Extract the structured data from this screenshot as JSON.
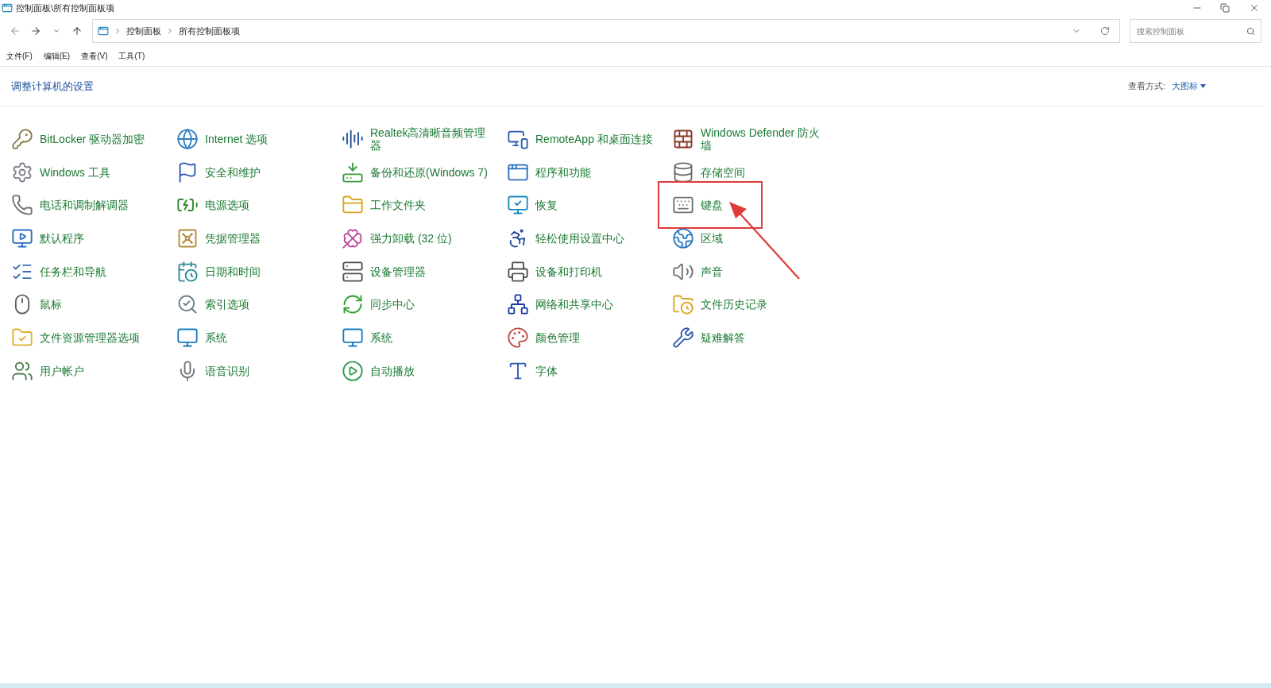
{
  "window": {
    "title": "控制面板\\所有控制面板项"
  },
  "address_bar": {
    "breadcrumbs": [
      "控制面板",
      "所有控制面板项"
    ]
  },
  "search": {
    "placeholder": "搜索控制面板"
  },
  "menu": [
    "文件(F)",
    "编辑(E)",
    "查看(V)",
    "工具(T)"
  ],
  "header": {
    "title": "调整计算机的设置",
    "view_label": "查看方式:",
    "view_value": "大图标"
  },
  "items": [
    {
      "label": "BitLocker 驱动器加密",
      "highlighted": false
    },
    {
      "label": "Internet 选项",
      "highlighted": false
    },
    {
      "label": "Realtek高清晰音频管理器",
      "highlighted": false
    },
    {
      "label": "RemoteApp 和桌面连接",
      "highlighted": false
    },
    {
      "label": "Windows Defender 防火墙",
      "highlighted": false
    },
    {
      "label": "Windows 工具",
      "highlighted": false
    },
    {
      "label": "安全和维护",
      "highlighted": false
    },
    {
      "label": "备份和还原(Windows 7)",
      "highlighted": false
    },
    {
      "label": "程序和功能",
      "highlighted": false
    },
    {
      "label": "存储空间",
      "highlighted": false
    },
    {
      "label": "电话和调制解调器",
      "highlighted": false
    },
    {
      "label": "电源选项",
      "highlighted": false
    },
    {
      "label": "工作文件夹",
      "highlighted": false
    },
    {
      "label": "恢复",
      "highlighted": false
    },
    {
      "label": "键盘",
      "highlighted": true
    },
    {
      "label": "默认程序",
      "highlighted": false
    },
    {
      "label": "凭据管理器",
      "highlighted": false
    },
    {
      "label": "强力卸载 (32 位)",
      "highlighted": false
    },
    {
      "label": "轻松使用设置中心",
      "highlighted": false
    },
    {
      "label": "区域",
      "highlighted": false
    },
    {
      "label": "任务栏和导航",
      "highlighted": false
    },
    {
      "label": "日期和时间",
      "highlighted": false
    },
    {
      "label": "设备管理器",
      "highlighted": false
    },
    {
      "label": "设备和打印机",
      "highlighted": false
    },
    {
      "label": "声音",
      "highlighted": false
    },
    {
      "label": "鼠标",
      "highlighted": false
    },
    {
      "label": "索引选项",
      "highlighted": false
    },
    {
      "label": "同步中心",
      "highlighted": false
    },
    {
      "label": "网络和共享中心",
      "highlighted": false
    },
    {
      "label": "文件历史记录",
      "highlighted": false
    },
    {
      "label": "文件资源管理器选项",
      "highlighted": false
    },
    {
      "label": "系统",
      "highlighted": false
    },
    {
      "label": "系统",
      "highlighted": false
    },
    {
      "label": "颜色管理",
      "highlighted": false
    },
    {
      "label": "疑难解答",
      "highlighted": false
    },
    {
      "label": "用户帐户",
      "highlighted": false
    },
    {
      "label": "语音识别",
      "highlighted": false
    },
    {
      "label": "自动播放",
      "highlighted": false
    },
    {
      "label": "字体",
      "highlighted": false
    }
  ]
}
